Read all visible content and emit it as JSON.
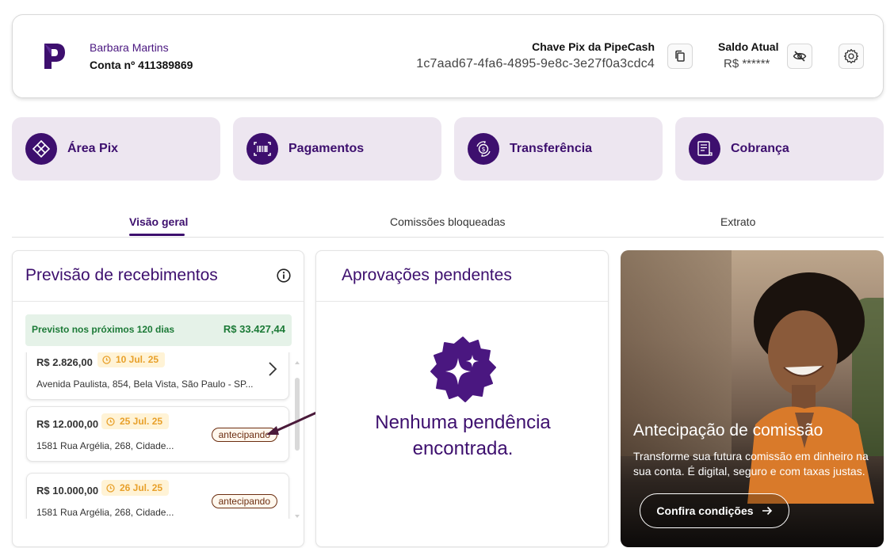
{
  "header": {
    "user_name": "Barbara Martins",
    "account_number": "Conta nº 411389869",
    "pix_label": "Chave Pix da PipeCash",
    "pix_key": "1c7aad67-4fa6-4895-9e8c-3e27f0a3cdc4",
    "balance_label": "Saldo Atual",
    "balance_value": "R$ ******"
  },
  "actions": [
    {
      "label": "Área Pix",
      "icon": "pix-icon"
    },
    {
      "label": "Pagamentos",
      "icon": "barcode-icon"
    },
    {
      "label": "Transferência",
      "icon": "transfer-icon"
    },
    {
      "label": "Cobrança",
      "icon": "invoice-icon"
    }
  ],
  "tabs": [
    {
      "label": "Visão geral",
      "active": true
    },
    {
      "label": "Comissões bloqueadas",
      "active": false
    },
    {
      "label": "Extrato",
      "active": false
    }
  ],
  "forecast": {
    "title": "Previsão de recebimentos",
    "summary_label": "Previsto nos próximos 120 dias",
    "summary_value": "R$ 33.427,44",
    "items": [
      {
        "amount": "R$ 2.826,00",
        "date": "10 Jul. 25",
        "address": "Avenida Paulista, 854, Bela Vista, São Paulo - SP...",
        "status": ""
      },
      {
        "amount": "R$ 12.000,00",
        "date": "25 Jul. 25",
        "address": "1581 Rua Argélia, 268, Cidade...",
        "status": "antecipando"
      },
      {
        "amount": "R$ 10.000,00",
        "date": "26 Jul. 25",
        "address": "1581 Rua Argélia, 268, Cidade...",
        "status": "antecipando"
      }
    ]
  },
  "approvals": {
    "title": "Aprovações pendentes",
    "empty_text": "Nenhuma pendência encontrada."
  },
  "promo": {
    "title": "Antecipação de comissão",
    "text": "Transforme sua futura comissão em dinheiro na sua conta. É digital, seguro e com taxas justas.",
    "button_label": "Confira condições"
  },
  "colors": {
    "brand_purple": "#3d0f6e",
    "tile_bg": "#ede6f0",
    "success_green": "#1c7a37",
    "date_orange": "#e8a02a"
  }
}
